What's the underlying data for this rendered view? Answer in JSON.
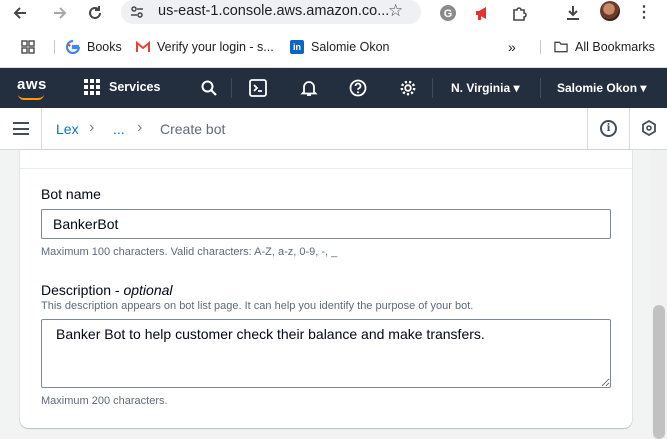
{
  "browser": {
    "url": "us-east-1.console.aws.amazon.co...",
    "bookmarks": [
      {
        "label": "Books",
        "icon": "google-icon"
      },
      {
        "label": "Verify your login - s...",
        "icon": "gmail-icon"
      },
      {
        "label": "Salomie Okon",
        "icon": "linkedin-icon"
      }
    ],
    "all_bookmarks": "All Bookmarks"
  },
  "aws_nav": {
    "logo": "aws",
    "services": "Services",
    "region": "N. Virginia ▾",
    "account": "Salomie Okon ▾"
  },
  "breadcrumb": {
    "items": [
      "Lex",
      "...",
      "Create bot"
    ]
  },
  "form": {
    "bot_name_label": "Bot name",
    "bot_name_value": "BankerBot",
    "bot_name_hint": "Maximum 100 characters. Valid characters: A-Z, a-z, 0-9, -, _",
    "description_label": "Description - ",
    "description_optional": "optional",
    "description_help": "This description appears on bot list page. It can help you identify the purpose of your bot.",
    "description_value": "Banker Bot to help customer check their balance and make transfers.",
    "description_hint": "Maximum 200 characters."
  },
  "colors": {
    "aws_nav_bg": "#232f3e",
    "aws_orange": "#ff9900",
    "link": "#0972d3"
  }
}
